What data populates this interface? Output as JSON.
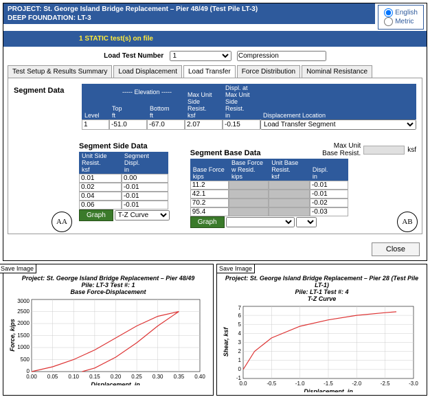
{
  "header": {
    "project_line": "PROJECT:  St. George Island Bridge Replacement – Pier 48/49 (Test Pile LT-3)",
    "foundation_line": "DEEP FOUNDATION: LT-3",
    "units": {
      "english": "English",
      "metric": "Metric",
      "selected": "english"
    }
  },
  "static_line": "1 STATIC test(s) on file",
  "load_test": {
    "label": "Load Test Number",
    "value": "1",
    "type": "Compression"
  },
  "tabs": [
    "Test Setup & Results Summary",
    "Load Displacement",
    "Load Transfer",
    "Force Distribution",
    "Nominal Resistance"
  ],
  "active_tab": 2,
  "segment_data": {
    "title": "Segment Data",
    "headers": {
      "level": "Level",
      "elev_group": "----- Elevation -----",
      "top": "Top",
      "top_unit": "ft",
      "bottom": "Bottom",
      "bottom_unit": "ft",
      "max_unit": "Max Unit Side Resist.",
      "max_unit_unit": "ksf",
      "displ": "Displ. at Max Unit Side Resist.",
      "displ_unit": "in",
      "loc": "Displacement Location"
    },
    "row": {
      "level": "1",
      "top": "-51.0",
      "bottom": "-67.0",
      "max": "2.07",
      "displ": "-0.15",
      "loc": "Load Transfer Segment"
    }
  },
  "side_data": {
    "title": "Segment Side Data",
    "headers": {
      "resist": "Unit Side Resist.",
      "resist_unit": "ksf",
      "displ": "Segment Displ.",
      "displ_unit": "in"
    },
    "rows": [
      {
        "r": "0.01",
        "d": "0.00"
      },
      {
        "r": "0.02",
        "d": "-0.01"
      },
      {
        "r": "0.04",
        "d": "-0.01"
      },
      {
        "r": "0.06",
        "d": "-0.01"
      }
    ],
    "graph_btn": "Graph",
    "graph_sel": "T-Z Curve"
  },
  "base_data": {
    "title": "Segment Base Data",
    "max_label": "Max Unit Base Resist.",
    "max_unit": "ksf",
    "headers": {
      "bforce": "Base Force",
      "bforce_unit": "kips",
      "bforcew": "Base Force w Resid.",
      "bforcew_unit": "kips",
      "ubr": "Unit Base Resist.",
      "ubr_unit": "ksf",
      "displ": "Displ.",
      "displ_unit": "in"
    },
    "rows": [
      {
        "bf": "11.2",
        "d": "-0.01"
      },
      {
        "bf": "42.1",
        "d": "-0.01"
      },
      {
        "bf": "70.2",
        "d": "-0.02"
      },
      {
        "bf": "95.4",
        "d": "-0.03"
      }
    ],
    "graph_btn": "Graph"
  },
  "markers": {
    "aa": "AA",
    "ab": "AB"
  },
  "close_btn": "Close",
  "charts": {
    "save_label": "Save Image",
    "left": {
      "title_lines": [
        "Project: St. George Island Bridge Replacement – Pier 48/49",
        "Pile: LT-3 Test #: 1",
        "Base Force-Displacement"
      ],
      "xlabel": "Displacement, in",
      "ylabel": "Force, kips"
    },
    "right": {
      "title_lines": [
        "Project: St. George Island Bridge Replacement – Pier 28 (Test Pile LT-1)",
        "Pile: LT-1 Test #: 4",
        "T-Z Curve"
      ],
      "xlabel": "Displacement, in",
      "ylabel": "Shear, ksf"
    }
  },
  "chart_data": [
    {
      "type": "line",
      "title": "Base Force-Displacement",
      "xlabel": "Displacement, in",
      "ylabel": "Force, kips",
      "xlim": [
        0,
        0.4
      ],
      "ylim": [
        0,
        3000
      ],
      "xticks": [
        0.0,
        0.05,
        0.1,
        0.15,
        0.2,
        0.25,
        0.3,
        0.35,
        0.4
      ],
      "yticks": [
        0,
        500,
        1000,
        1500,
        2000,
        2500,
        3000
      ],
      "series": [
        {
          "name": "loading",
          "x": [
            0.0,
            0.05,
            0.1,
            0.15,
            0.2,
            0.25,
            0.3,
            0.35
          ],
          "y": [
            0,
            200,
            500,
            900,
            1400,
            1900,
            2300,
            2500
          ]
        },
        {
          "name": "unloading",
          "x": [
            0.35,
            0.3,
            0.25,
            0.2,
            0.15,
            0.12
          ],
          "y": [
            2500,
            1900,
            1200,
            600,
            150,
            0
          ]
        }
      ]
    },
    {
      "type": "line",
      "title": "T-Z Curve",
      "xlabel": "Displacement, in",
      "ylabel": "Shear, ksf",
      "xlim": [
        0,
        -3.0
      ],
      "ylim": [
        -1,
        7
      ],
      "xticks": [
        0.0,
        -0.5,
        -1.0,
        -1.5,
        -2.0,
        -2.5,
        -3.0
      ],
      "yticks": [
        -1,
        0,
        1,
        2,
        3,
        4,
        5,
        6,
        7
      ],
      "series": [
        {
          "name": "tz",
          "x": [
            0.0,
            -0.2,
            -0.5,
            -1.0,
            -1.5,
            -2.0,
            -2.5,
            -2.7
          ],
          "y": [
            0,
            2.0,
            3.5,
            4.8,
            5.5,
            6.0,
            6.3,
            6.4
          ]
        }
      ]
    }
  ]
}
